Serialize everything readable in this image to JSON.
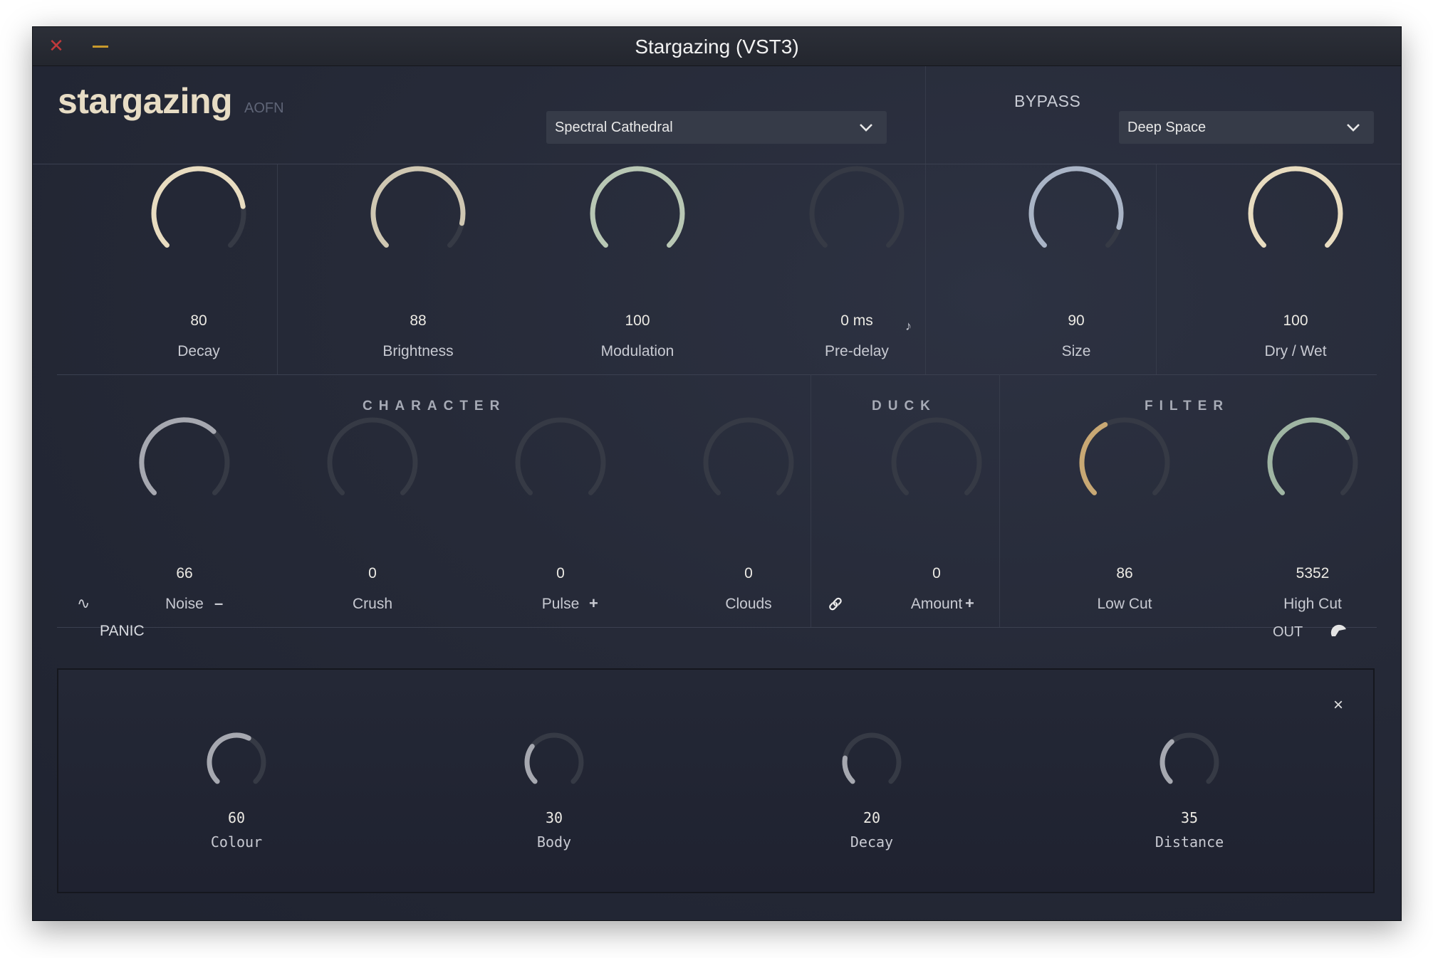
{
  "window": {
    "title": "Stargazing (VST3)"
  },
  "header": {
    "brand": "stargazing",
    "brand_sub": "AOFN",
    "preset_selected": "Spectral Cathedral",
    "bypass_label": "BYPASS",
    "mode_selected": "Deep Space"
  },
  "main_knobs": [
    {
      "value": "80",
      "label": "Decay",
      "level": 0.8,
      "color": "#e8dcc0"
    },
    {
      "value": "88",
      "label": "Brightness",
      "level": 0.88,
      "color": "#cfc7b2"
    },
    {
      "value": "100",
      "label": "Modulation",
      "level": 1.0,
      "color": "#b8c7b4"
    },
    {
      "value": "0 ms",
      "label": "Pre-delay",
      "level": 0.0,
      "color": "#cfc7b2"
    },
    {
      "value": "90",
      "label": "Size",
      "level": 0.9,
      "color": "#a9b4c6"
    },
    {
      "value": "100",
      "label": "Dry / Wet",
      "level": 1.0,
      "color": "#e8dcc0"
    }
  ],
  "sections": {
    "character": "CHARACTER",
    "duck": "DUCK",
    "filter": "FILTER"
  },
  "mid_knobs": [
    {
      "value": "66",
      "label": "Noise",
      "level": 0.66,
      "color": "#a6a8b0"
    },
    {
      "value": "0",
      "label": "Crush",
      "level": 0.0,
      "color": "#a6a8b0"
    },
    {
      "value": "0",
      "label": "Pulse",
      "level": 0.0,
      "color": "#a6a8b0"
    },
    {
      "value": "0",
      "label": "Clouds",
      "level": 0.0,
      "color": "#a6a8b0"
    },
    {
      "value": "0",
      "label": "Amount",
      "level": 0.0,
      "color": "#a6a8b0"
    },
    {
      "value": "86",
      "label": "Low Cut",
      "level": 0.4,
      "color": "#c8a874"
    },
    {
      "value": "5352",
      "label": "High Cut",
      "level": 0.7,
      "color": "#9fb5a3"
    }
  ],
  "icons": {
    "noise_wave": "∿",
    "noise_minus": "–",
    "pulse_plus": "+",
    "duck_link": "🔗",
    "duck_plus": "+",
    "predelay_sync": "♪",
    "close": "×"
  },
  "panic_label": "PANIC",
  "out_label": "OUT",
  "bottom_knobs": [
    {
      "value": "60",
      "label": "Colour",
      "level": 0.6,
      "color": "#a6a8b0"
    },
    {
      "value": "30",
      "label": "Body",
      "level": 0.3,
      "color": "#a6a8b0"
    },
    {
      "value": "20",
      "label": "Decay",
      "level": 0.2,
      "color": "#a6a8b0"
    },
    {
      "value": "35",
      "label": "Distance",
      "level": 0.35,
      "color": "#a6a8b0"
    }
  ]
}
